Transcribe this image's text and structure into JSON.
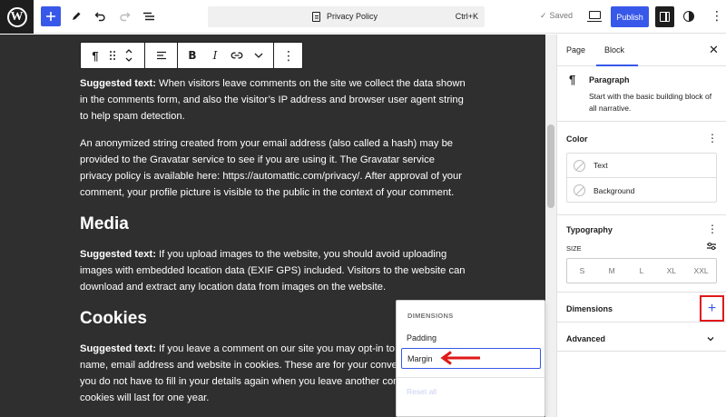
{
  "topbar": {
    "document_title": "Privacy Policy",
    "shortcut": "Ctrl+K",
    "saved_label": "Saved",
    "publish_label": "Publish",
    "icons": [
      "wordpress-logo-icon",
      "plus-icon",
      "pencil-icon",
      "undo-icon",
      "redo-icon",
      "list-view-icon",
      "page-icon",
      "check-icon",
      "desktop-preview-icon",
      "settings-panel-icon",
      "styles-half-circle-icon",
      "vertical-dots-icon"
    ]
  },
  "editor": {
    "block_toolbar_icons": [
      "paragraph-icon",
      "drag-handle-icon",
      "move-up-down-icon",
      "align-icon",
      "bold-icon",
      "italic-icon",
      "link-icon",
      "chevron-down-icon",
      "more-options-icon"
    ],
    "paragraphs": {
      "p1_prefix": "Suggested text:",
      "p1_text": " When visitors leave comments on the site we collect the data shown in the comments form, and also the visitor’s IP address and browser user agent string to help spam detection.",
      "p2_text": "An anonymized string created from your email address (also called a hash) may be provided to the Gravatar service to see if you are using it. The Gravatar service privacy policy is available here: https://automattic.com/privacy/. After approval of your comment, your profile picture is visible to the public in the context of your comment.",
      "h_media": "Media",
      "p3_prefix": "Suggested text:",
      "p3_text": " If you upload images to the website, you should avoid uploading images with embedded location data (EXIF GPS) included. Visitors to the website can download and extract any location data from images on the website.",
      "h_cookies": "Cookies",
      "p4_prefix": "Suggested text:",
      "p4_text": " If you leave a comment on our site you may opt-in to saving your name, email address and website in cookies. These are for your convenience so that you do not have to fill in your details again when you leave another comment. These cookies will last for one year."
    }
  },
  "popover": {
    "heading": "DIMENSIONS",
    "items": [
      "Padding",
      "Margin"
    ],
    "selected": "Margin",
    "reset_label": "Reset all"
  },
  "sidebar": {
    "tabs": [
      "Page",
      "Block"
    ],
    "active_tab": "Block",
    "block_card": {
      "title": "Paragraph",
      "description": "Start with the basic building block of all narrative."
    },
    "color": {
      "title": "Color",
      "items": [
        "Text",
        "Background"
      ]
    },
    "typography": {
      "title": "Typography",
      "size_label": "SIZE",
      "sizes": [
        "S",
        "M",
        "L",
        "XL",
        "XXL"
      ]
    },
    "dimensions": {
      "title": "Dimensions"
    },
    "advanced": {
      "title": "Advanced"
    }
  },
  "colors": {
    "accent": "#3858e9",
    "highlight": "#e01818",
    "canvas_bg": "#2f2f2f"
  }
}
